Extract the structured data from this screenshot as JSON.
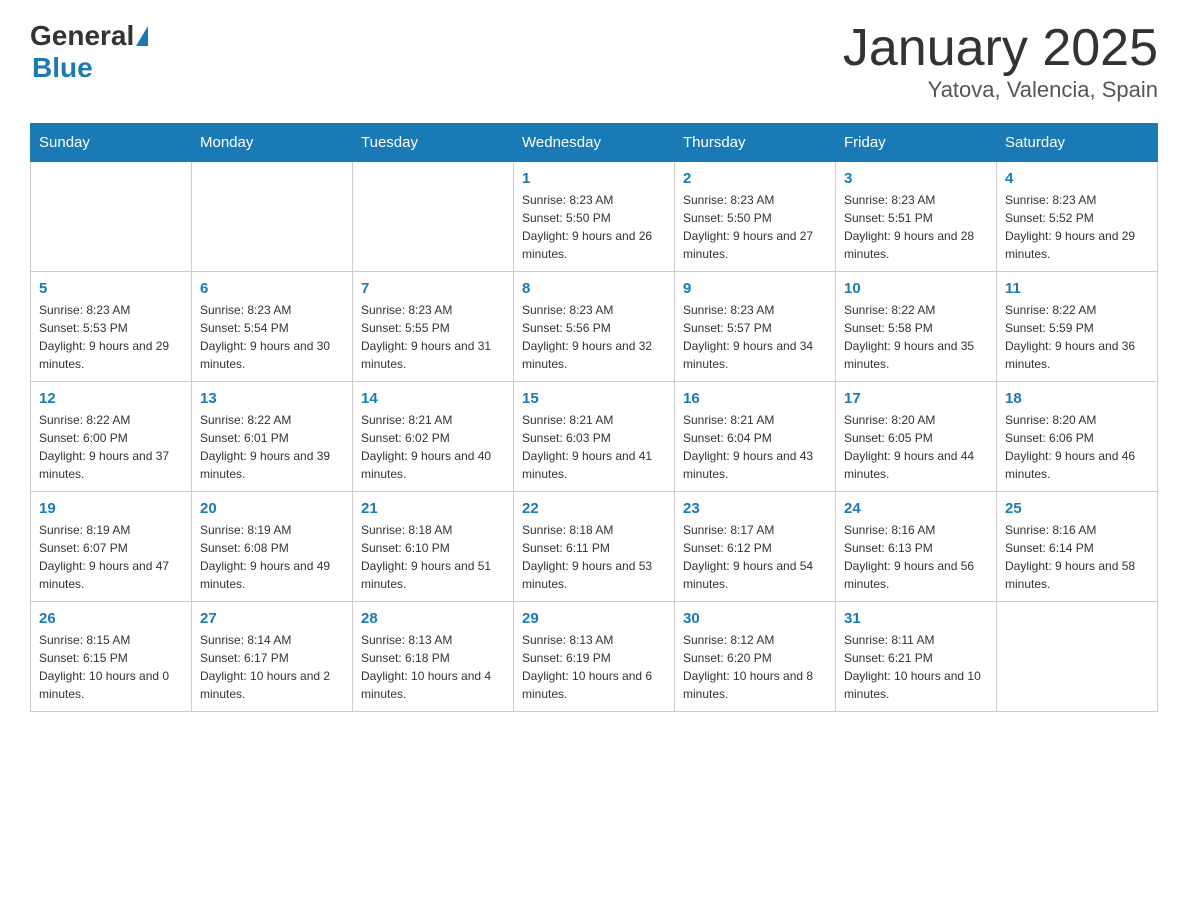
{
  "header": {
    "logo": {
      "general": "General",
      "blue": "Blue"
    },
    "title": "January 2025",
    "subtitle": "Yatova, Valencia, Spain"
  },
  "columns": [
    "Sunday",
    "Monday",
    "Tuesday",
    "Wednesday",
    "Thursday",
    "Friday",
    "Saturday"
  ],
  "weeks": [
    [
      {
        "day": "",
        "info": ""
      },
      {
        "day": "",
        "info": ""
      },
      {
        "day": "",
        "info": ""
      },
      {
        "day": "1",
        "info": "Sunrise: 8:23 AM\nSunset: 5:50 PM\nDaylight: 9 hours and 26 minutes."
      },
      {
        "day": "2",
        "info": "Sunrise: 8:23 AM\nSunset: 5:50 PM\nDaylight: 9 hours and 27 minutes."
      },
      {
        "day": "3",
        "info": "Sunrise: 8:23 AM\nSunset: 5:51 PM\nDaylight: 9 hours and 28 minutes."
      },
      {
        "day": "4",
        "info": "Sunrise: 8:23 AM\nSunset: 5:52 PM\nDaylight: 9 hours and 29 minutes."
      }
    ],
    [
      {
        "day": "5",
        "info": "Sunrise: 8:23 AM\nSunset: 5:53 PM\nDaylight: 9 hours and 29 minutes."
      },
      {
        "day": "6",
        "info": "Sunrise: 8:23 AM\nSunset: 5:54 PM\nDaylight: 9 hours and 30 minutes."
      },
      {
        "day": "7",
        "info": "Sunrise: 8:23 AM\nSunset: 5:55 PM\nDaylight: 9 hours and 31 minutes."
      },
      {
        "day": "8",
        "info": "Sunrise: 8:23 AM\nSunset: 5:56 PM\nDaylight: 9 hours and 32 minutes."
      },
      {
        "day": "9",
        "info": "Sunrise: 8:23 AM\nSunset: 5:57 PM\nDaylight: 9 hours and 34 minutes."
      },
      {
        "day": "10",
        "info": "Sunrise: 8:22 AM\nSunset: 5:58 PM\nDaylight: 9 hours and 35 minutes."
      },
      {
        "day": "11",
        "info": "Sunrise: 8:22 AM\nSunset: 5:59 PM\nDaylight: 9 hours and 36 minutes."
      }
    ],
    [
      {
        "day": "12",
        "info": "Sunrise: 8:22 AM\nSunset: 6:00 PM\nDaylight: 9 hours and 37 minutes."
      },
      {
        "day": "13",
        "info": "Sunrise: 8:22 AM\nSunset: 6:01 PM\nDaylight: 9 hours and 39 minutes."
      },
      {
        "day": "14",
        "info": "Sunrise: 8:21 AM\nSunset: 6:02 PM\nDaylight: 9 hours and 40 minutes."
      },
      {
        "day": "15",
        "info": "Sunrise: 8:21 AM\nSunset: 6:03 PM\nDaylight: 9 hours and 41 minutes."
      },
      {
        "day": "16",
        "info": "Sunrise: 8:21 AM\nSunset: 6:04 PM\nDaylight: 9 hours and 43 minutes."
      },
      {
        "day": "17",
        "info": "Sunrise: 8:20 AM\nSunset: 6:05 PM\nDaylight: 9 hours and 44 minutes."
      },
      {
        "day": "18",
        "info": "Sunrise: 8:20 AM\nSunset: 6:06 PM\nDaylight: 9 hours and 46 minutes."
      }
    ],
    [
      {
        "day": "19",
        "info": "Sunrise: 8:19 AM\nSunset: 6:07 PM\nDaylight: 9 hours and 47 minutes."
      },
      {
        "day": "20",
        "info": "Sunrise: 8:19 AM\nSunset: 6:08 PM\nDaylight: 9 hours and 49 minutes."
      },
      {
        "day": "21",
        "info": "Sunrise: 8:18 AM\nSunset: 6:10 PM\nDaylight: 9 hours and 51 minutes."
      },
      {
        "day": "22",
        "info": "Sunrise: 8:18 AM\nSunset: 6:11 PM\nDaylight: 9 hours and 53 minutes."
      },
      {
        "day": "23",
        "info": "Sunrise: 8:17 AM\nSunset: 6:12 PM\nDaylight: 9 hours and 54 minutes."
      },
      {
        "day": "24",
        "info": "Sunrise: 8:16 AM\nSunset: 6:13 PM\nDaylight: 9 hours and 56 minutes."
      },
      {
        "day": "25",
        "info": "Sunrise: 8:16 AM\nSunset: 6:14 PM\nDaylight: 9 hours and 58 minutes."
      }
    ],
    [
      {
        "day": "26",
        "info": "Sunrise: 8:15 AM\nSunset: 6:15 PM\nDaylight: 10 hours and 0 minutes."
      },
      {
        "day": "27",
        "info": "Sunrise: 8:14 AM\nSunset: 6:17 PM\nDaylight: 10 hours and 2 minutes."
      },
      {
        "day": "28",
        "info": "Sunrise: 8:13 AM\nSunset: 6:18 PM\nDaylight: 10 hours and 4 minutes."
      },
      {
        "day": "29",
        "info": "Sunrise: 8:13 AM\nSunset: 6:19 PM\nDaylight: 10 hours and 6 minutes."
      },
      {
        "day": "30",
        "info": "Sunrise: 8:12 AM\nSunset: 6:20 PM\nDaylight: 10 hours and 8 minutes."
      },
      {
        "day": "31",
        "info": "Sunrise: 8:11 AM\nSunset: 6:21 PM\nDaylight: 10 hours and 10 minutes."
      },
      {
        "day": "",
        "info": ""
      }
    ]
  ]
}
